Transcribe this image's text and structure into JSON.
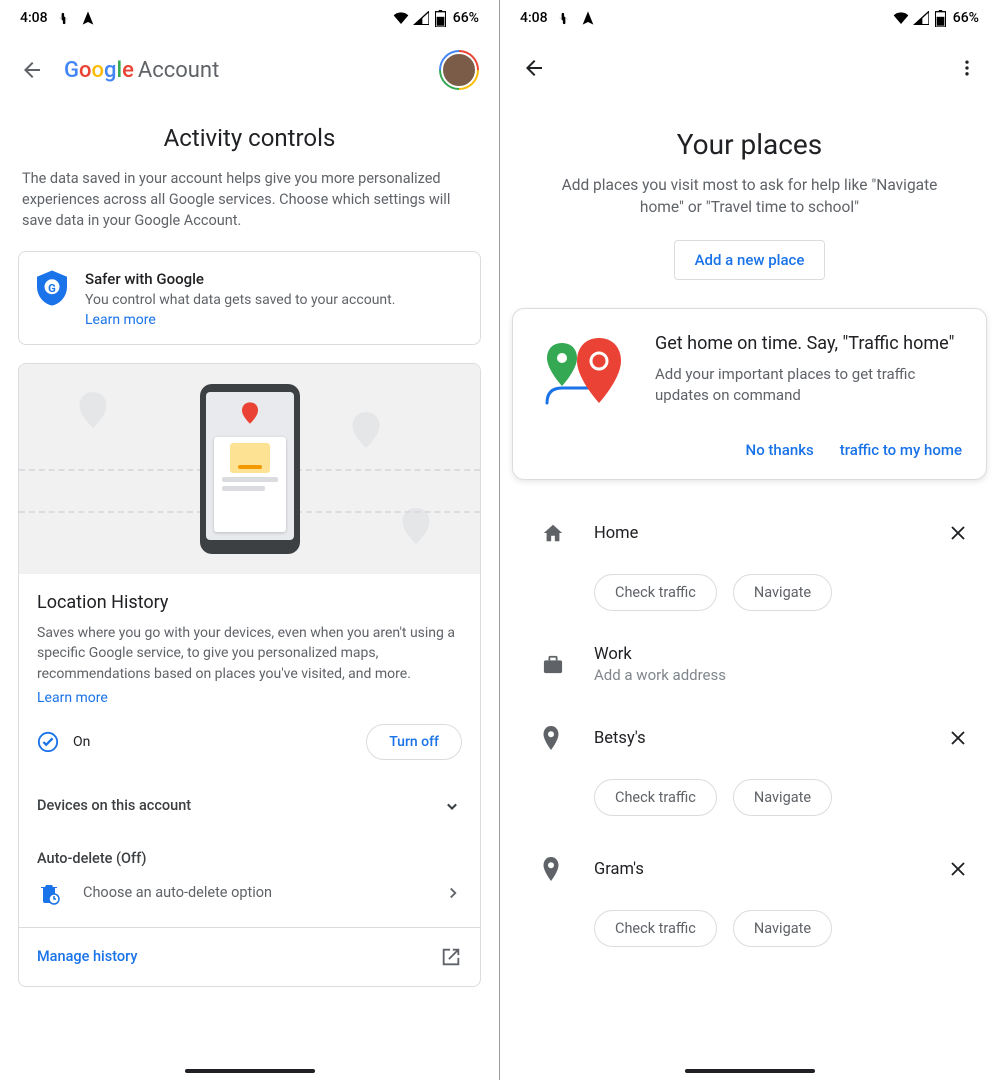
{
  "status": {
    "time": "4:08",
    "battery": "66%"
  },
  "left": {
    "brand_account": "Account",
    "page_title": "Activity controls",
    "intro": "The data saved in your account helps give you more personalized experiences across all Google services. Choose which settings will save data in your Google Account.",
    "safer": {
      "title": "Safer with Google",
      "sub": "You control what data gets saved to your account.",
      "learn_more": "Learn more"
    },
    "location_history": {
      "title": "Location History",
      "desc": "Saves where you go with your devices, even when you aren't using a specific Google service, to give you personalized maps, recommendations based on places you've visited, and more.",
      "learn_more": "Learn more",
      "status_label": "On",
      "turn_off": "Turn off"
    },
    "devices_label": "Devices on this account",
    "auto_delete": {
      "label": "Auto-delete (Off)",
      "option": "Choose an auto-delete option"
    },
    "manage_history": "Manage history"
  },
  "right": {
    "title": "Your places",
    "sub": "Add places you visit most to ask for help like \"Navigate home\" or \"Travel time to school\"",
    "add_button": "Add a new place",
    "promo": {
      "title": "Get home on time. Say, \"Traffic home\"",
      "desc": "Add your important places to get traffic updates on command",
      "no_thanks": "No thanks",
      "traffic_home": "traffic to my home"
    },
    "places": [
      {
        "name": "Home",
        "icon": "home",
        "chips": [
          "Check traffic",
          "Navigate"
        ],
        "removable": true
      },
      {
        "name": "Work",
        "sub": "Add a work address",
        "icon": "work",
        "chips": [],
        "removable": false
      },
      {
        "name": "Betsy's",
        "icon": "pin",
        "chips": [
          "Check traffic",
          "Navigate"
        ],
        "removable": true
      },
      {
        "name": "Gram's",
        "icon": "pin",
        "chips": [
          "Check traffic",
          "Navigate"
        ],
        "removable": true
      }
    ]
  }
}
